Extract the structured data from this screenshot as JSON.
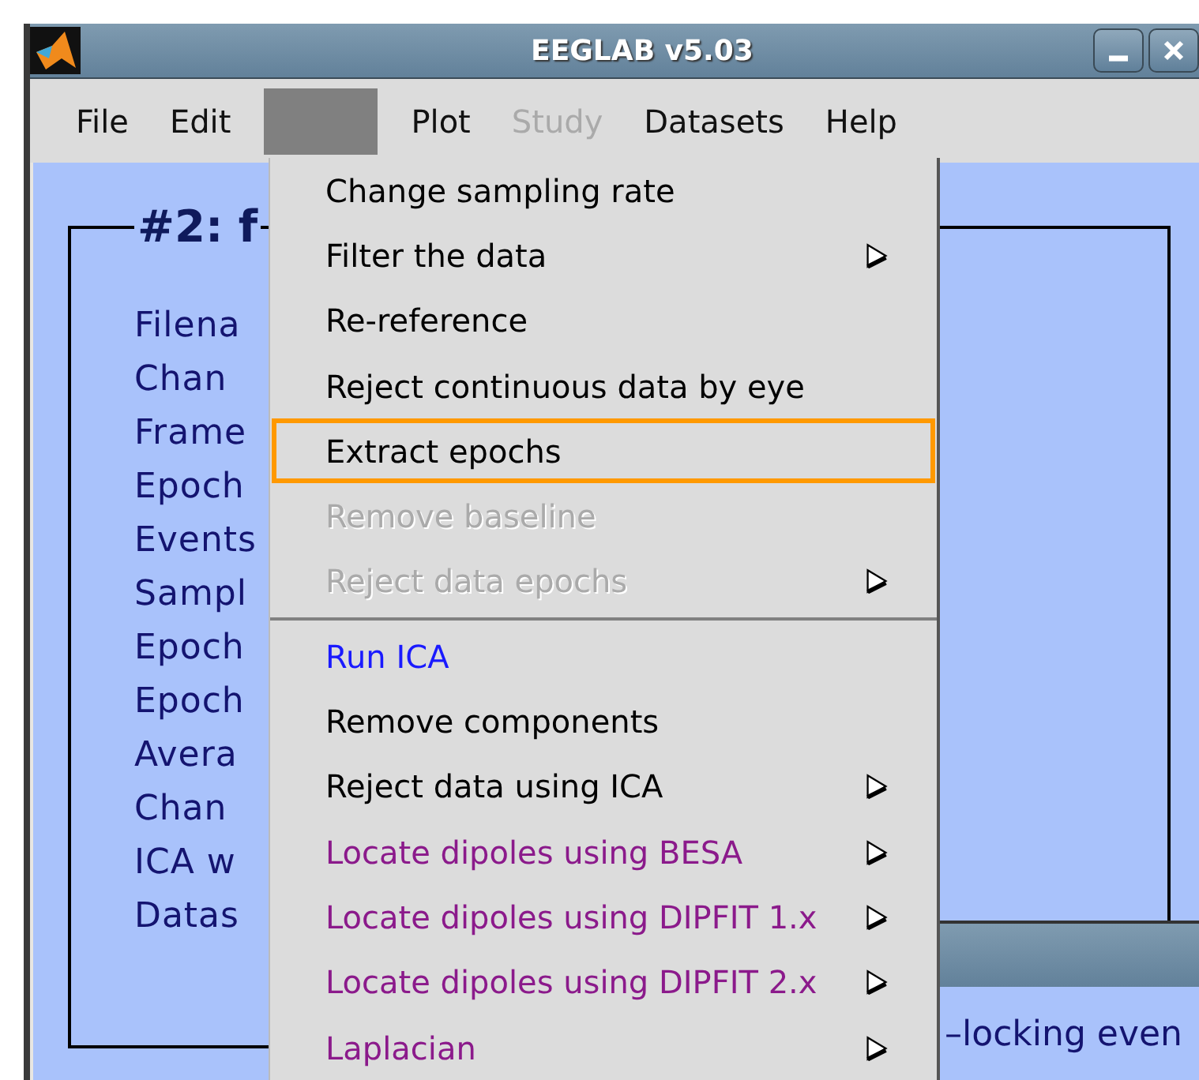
{
  "window": {
    "title": "EEGLAB v5.03"
  },
  "menubar": [
    {
      "label": "File",
      "selected": false,
      "disabled": false
    },
    {
      "label": "Edit",
      "selected": false,
      "disabled": false
    },
    {
      "selected": true,
      "disabled": false
    },
    {
      "label": "Plot",
      "selected": false,
      "disabled": false
    },
    {
      "label": "Study",
      "selected": false,
      "disabled": true
    },
    {
      "label": "Datasets",
      "selected": false,
      "disabled": false
    },
    {
      "label": "Help",
      "selected": false,
      "disabled": false
    }
  ],
  "panel": {
    "title": "#2: f",
    "labels": [
      "Filena",
      "Chan",
      "Frame",
      "Epoch",
      "Events",
      "Sampl",
      "Epoch",
      "Epoch",
      "Avera",
      "Chan",
      "ICA w",
      "Datas"
    ]
  },
  "menu": [
    {
      "label": "Change sampling rate",
      "color": "#000000",
      "disabled": false,
      "submenu": false,
      "selected": false
    },
    {
      "label": "Filter the data",
      "color": "#000000",
      "disabled": false,
      "submenu": true,
      "selected": false
    },
    {
      "label": "Re-reference",
      "color": "#000000",
      "disabled": false,
      "submenu": false,
      "selected": false
    },
    {
      "label": "Reject continuous data by eye",
      "color": "#000000",
      "disabled": false,
      "submenu": false,
      "selected": false
    },
    {
      "label": "Extract epochs",
      "color": "#000000",
      "disabled": false,
      "submenu": false,
      "selected": true
    },
    {
      "label": "Remove baseline",
      "disabled": true,
      "submenu": false,
      "selected": false
    },
    {
      "label": "Reject data epochs",
      "disabled": true,
      "submenu": true,
      "selected": false,
      "separator_after": true
    },
    {
      "label": "Run ICA",
      "color": "#1a1aff",
      "disabled": false,
      "submenu": false,
      "selected": false
    },
    {
      "label": "Remove components",
      "color": "#000000",
      "disabled": false,
      "submenu": false,
      "selected": false
    },
    {
      "label": "Reject data using ICA",
      "color": "#000000",
      "disabled": false,
      "submenu": true,
      "selected": false
    },
    {
      "label": "Locate dipoles using BESA",
      "color": "#8b1a8b",
      "disabled": false,
      "submenu": true,
      "selected": false
    },
    {
      "label": "Locate dipoles using DIPFIT 1.x",
      "color": "#8b1a8b",
      "disabled": false,
      "submenu": true,
      "selected": false
    },
    {
      "label": "Locate dipoles using DIPFIT 2.x",
      "color": "#8b1a8b",
      "disabled": false,
      "submenu": true,
      "selected": false
    },
    {
      "label": "Laplacian",
      "color": "#8b1a8b",
      "disabled": false,
      "submenu": true,
      "selected": false
    }
  ],
  "second_window": {
    "text": "–locking even"
  }
}
